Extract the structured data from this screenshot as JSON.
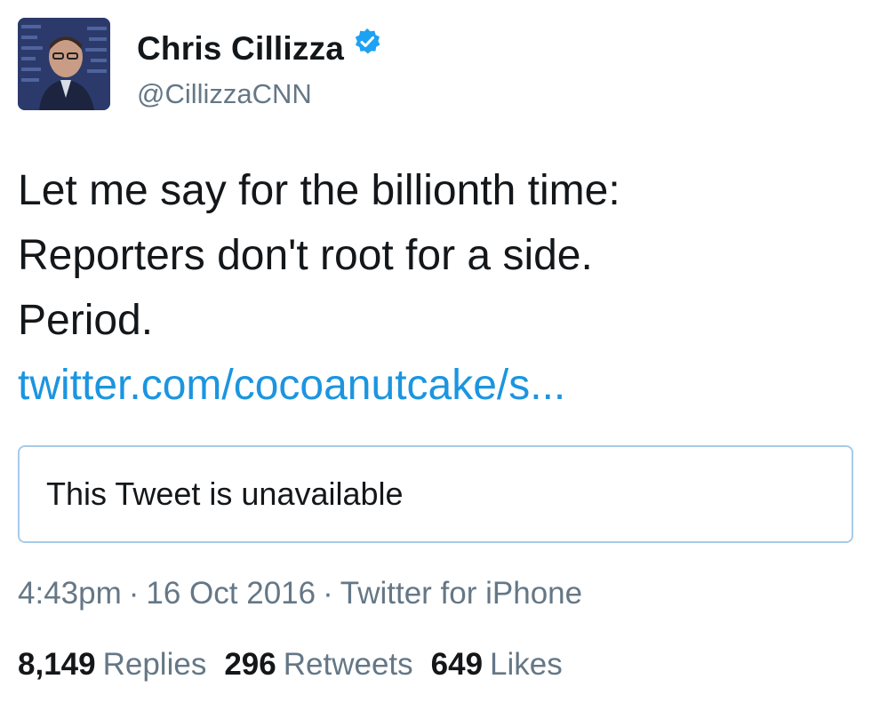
{
  "author": {
    "display_name": "Chris Cillizza",
    "handle": "@CillizzaCNN",
    "verified_icon": "verified-badge-icon"
  },
  "tweet": {
    "lines": [
      "Let me say for the billionth time:",
      "Reporters don't root for a side.",
      "Period."
    ],
    "link_text": "twitter.com/cocoanutcake/s..."
  },
  "quoted_tweet": {
    "text": "This Tweet is unavailable"
  },
  "meta": {
    "time": "4:43pm",
    "separator": "·",
    "date": "16 Oct 2016",
    "source": "Twitter for iPhone"
  },
  "stats": {
    "replies_count": "8,149",
    "replies_label": "Replies",
    "retweets_count": "296",
    "retweets_label": "Retweets",
    "likes_count": "649",
    "likes_label": "Likes"
  },
  "colors": {
    "link": "#1b95e0",
    "muted": "#657786",
    "text": "#14171a",
    "border": "#a7cbe8"
  }
}
